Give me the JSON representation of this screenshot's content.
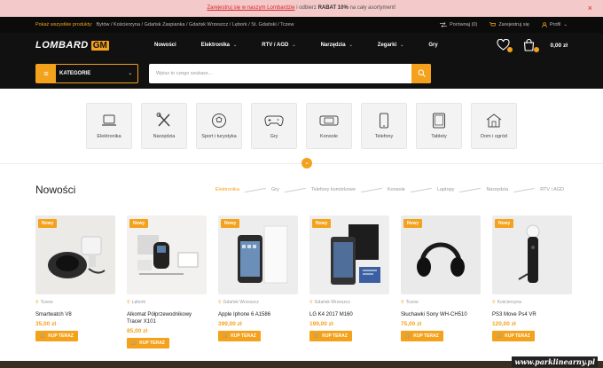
{
  "promo": {
    "link_text": "Zarejestruj się w naszym Lombardzie",
    "middle": " i odbierz ",
    "bold": "RABAT 10%",
    "tail": " na cały asortyment!",
    "close": "×"
  },
  "topbar": {
    "show_label": "Pokaż wszystkie produkty:",
    "locations": "Bytów / Kościerzyna / Gdańsk Zaspianka / Gdańsk Wrzeszcz / Lębork / St. Gdański / Tczew",
    "compare": "Porównaj (0)",
    "register": "Zarejestruj się",
    "profile": "Profil"
  },
  "nav": {
    "logo_text": "LOMBARD",
    "logo_mark": "GM",
    "menu": [
      {
        "label": "Nowości",
        "dropdown": false
      },
      {
        "label": "Elektronika",
        "dropdown": true
      },
      {
        "label": "RTV / AGD",
        "dropdown": true
      },
      {
        "label": "Narzędzia",
        "dropdown": true
      },
      {
        "label": "Zegarki",
        "dropdown": true
      },
      {
        "label": "Gry",
        "dropdown": false
      }
    ],
    "cart_total": "0,00 zł"
  },
  "search": {
    "categories_label": "KATEGORIE",
    "placeholder": "Wpisz to czego szukasz..."
  },
  "categories": [
    {
      "label": "Elektronika",
      "icon": "laptop-icon"
    },
    {
      "label": "Narzędzia",
      "icon": "tools-icon"
    },
    {
      "label": "Sport i turystyka",
      "icon": "ball-icon"
    },
    {
      "label": "Gry",
      "icon": "gamepad-icon"
    },
    {
      "label": "Konsole",
      "icon": "console-icon"
    },
    {
      "label": "Telefony",
      "icon": "phone-icon"
    },
    {
      "label": "Tablety",
      "icon": "tablet-icon"
    },
    {
      "label": "Dom i ogród",
      "icon": "house-icon"
    }
  ],
  "news": {
    "title": "Nowości",
    "tabs": [
      "Elektronika",
      "Gry",
      "Telefony komórkowe",
      "Konsole",
      "Laptopy",
      "Narzędzia",
      "RTV i AGD"
    ],
    "active_tab": "Elektronika"
  },
  "products": [
    {
      "badge": "Nowy",
      "location": "Tczew",
      "name": "Smartwatch V8",
      "price": "35,00 zł",
      "buy": "KUP TERAZ"
    },
    {
      "badge": "Nowy",
      "location": "Lębork",
      "name": "Alkomat Półprzewodnikowy Tracer X101",
      "price": "85,00 zł",
      "buy": "KUP TERAZ"
    },
    {
      "badge": "Nowy",
      "location": "Gdańsk Wrzeszcz",
      "name": "Apple Iphone 6 A1586",
      "price": "399,00 zł",
      "buy": "KUP TERAZ"
    },
    {
      "badge": "Nowy",
      "location": "Gdańsk Wrzeszcz",
      "name": "LG K4 2017 M160",
      "price": "199,00 zł",
      "buy": "KUP TERAZ"
    },
    {
      "badge": "Nowy",
      "location": "Tczew",
      "name": "Słuchawki Sony WH-CH510",
      "price": "75,00 zł",
      "buy": "KUP TERAZ"
    },
    {
      "badge": "Nowy",
      "location": "Kościerzyna",
      "name": "PS3 Move Ps4 VR",
      "price": "120,00 zł",
      "buy": "KUP TERAZ"
    }
  ],
  "watermark": "www.parklinearny.pl",
  "colors": {
    "accent": "#f4a11c",
    "dark": "#111111",
    "promo_bg": "#f3c9c9",
    "promo_link": "#d9262a"
  }
}
